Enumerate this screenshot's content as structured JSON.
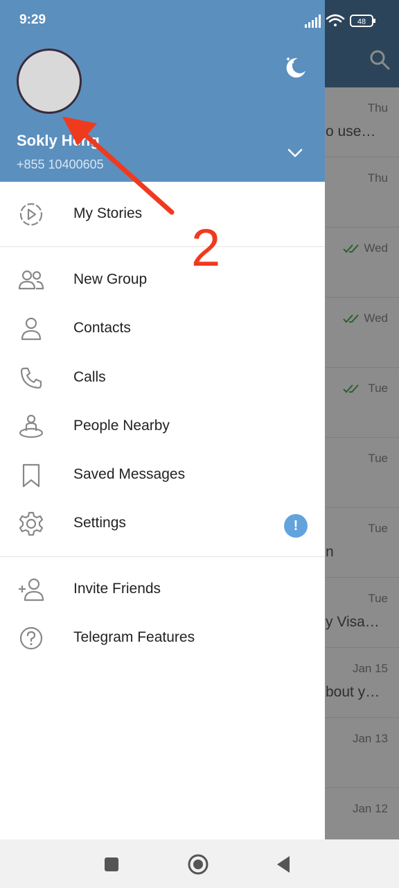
{
  "status_bar": {
    "time": "9:29",
    "battery": "48"
  },
  "profile": {
    "name": "Sokly Heng",
    "phone": "+855 10400605"
  },
  "menu": {
    "my_stories": "My Stories",
    "new_group": "New Group",
    "contacts": "Contacts",
    "calls": "Calls",
    "people_nearby": "People Nearby",
    "saved_messages": "Saved Messages",
    "settings": "Settings",
    "settings_badge": "!",
    "invite_friends": "Invite Friends",
    "telegram_features": "Telegram Features"
  },
  "background_chats": [
    {
      "time": "Thu",
      "preview": "o use…",
      "read": false
    },
    {
      "time": "Thu",
      "preview": "",
      "read": false
    },
    {
      "time": "Wed",
      "preview": "",
      "read": true
    },
    {
      "time": "Wed",
      "preview": "",
      "read": true
    },
    {
      "time": "Tue",
      "preview": "",
      "read": true
    },
    {
      "time": "Tue",
      "preview": "",
      "read": false
    },
    {
      "time": "Tue",
      "preview": "n",
      "read": false
    },
    {
      "time": "Tue",
      "preview": "y Visa…",
      "read": false
    },
    {
      "time": "Jan 15",
      "preview": "bout y…",
      "read": false
    },
    {
      "time": "Jan 13",
      "preview": "",
      "read": false
    },
    {
      "time": "Jan 12",
      "preview": "",
      "read": false
    }
  ],
  "annotation": {
    "number": "2"
  },
  "colors": {
    "header": "#5b8fbe",
    "badge": "#62a3dd",
    "annotation": "#f03a1e",
    "check": "#4caf50"
  }
}
